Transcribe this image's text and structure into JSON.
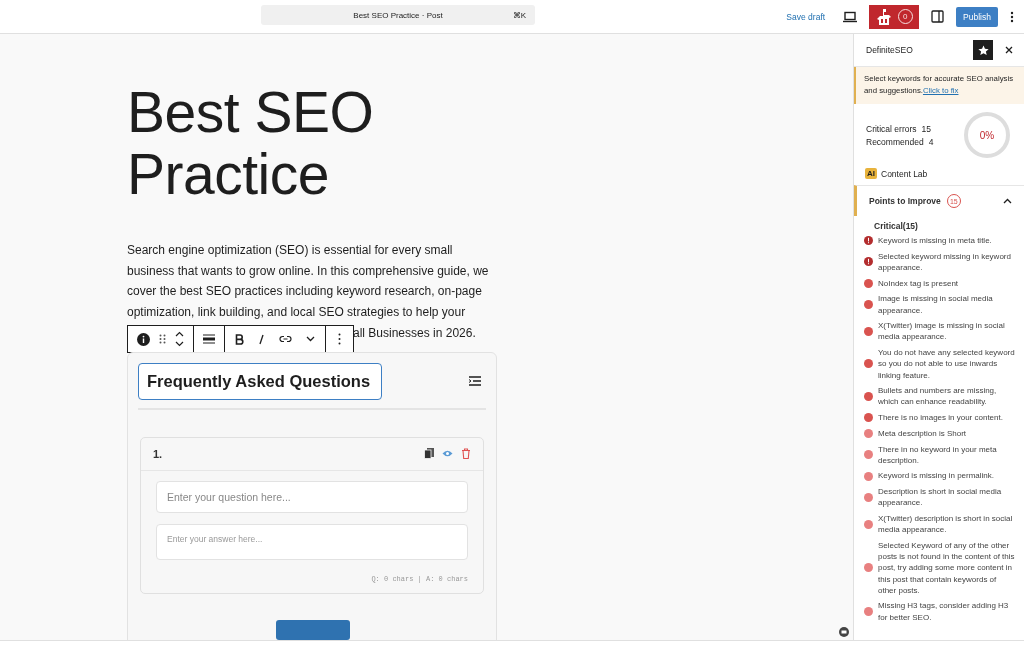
{
  "top_bar": {
    "document_title": "Best SEO Practice · Post",
    "shortcut": "⌘K",
    "save_draft": "Save draft",
    "plugin_score": "0",
    "publish": "Publish"
  },
  "editor": {
    "title": "Best SEO Practice",
    "paragraph": "Search engine optimization (SEO) is essential for every small business that wants to grow online. In this comprehensive guide, we cover the best SEO practices including keyword research, on-page optimization, link building, and local SEO strategies to help your",
    "paragraph_tail": "all Businesses in 2026.",
    "faq": {
      "heading": "Frequently Asked Questions",
      "items": [
        {
          "number": "1.",
          "question_placeholder": "Enter your question here...",
          "answer_placeholder": "Enter your answer here...",
          "counter": "Q: 0 chars | A: 0 chars"
        }
      ]
    }
  },
  "sidebar": {
    "title": "DefiniteSEO",
    "notice": "Select keywords for accurate SEO analysis and suggestions.",
    "notice_link": "Click to fix",
    "critical_errors_label": "Critical errors",
    "critical_errors": "15",
    "recommended_label": "Recommended",
    "recommended": "4",
    "score": "0%",
    "ai_badge": "AI",
    "content_lab": "Content Lab",
    "section": {
      "title": "Points to Improve",
      "count": "15",
      "expanded": true,
      "group": "Critical(15)",
      "issues": [
        {
          "kind": "alert",
          "color": "#b32d2e",
          "text": "Keyword is missing in meta title."
        },
        {
          "kind": "alert",
          "color": "#b32d2e",
          "text": "Selected keyword missing in keyword appearance."
        },
        {
          "kind": "dot",
          "color": "#d9534f",
          "text": "NoIndex tag is present"
        },
        {
          "kind": "dot",
          "color": "#d9534f",
          "text": "Image is missing in social media appearance."
        },
        {
          "kind": "dot",
          "color": "#d9534f",
          "text": "X(Twitter) image is missing in social media appearance."
        },
        {
          "kind": "dot",
          "color": "#d9534f",
          "text": "You do not have any selected keyword so you do not able to use inwards linking feature."
        },
        {
          "kind": "dot",
          "color": "#d9534f",
          "text": "Bullets and numbers are missing, which can enhance readability."
        },
        {
          "kind": "dot",
          "color": "#d9534f",
          "text": "There is no images in your content."
        },
        {
          "kind": "dot",
          "color": "#e88080",
          "text": "Meta description is Short"
        },
        {
          "kind": "dot",
          "color": "#e88080",
          "text": "There in no keyword in your meta description."
        },
        {
          "kind": "dot",
          "color": "#e88080",
          "text": "Keyword is missing in permalink."
        },
        {
          "kind": "dot",
          "color": "#e88080",
          "text": "Description is short in social media appearance."
        },
        {
          "kind": "dot",
          "color": "#e88080",
          "text": "X(Twitter) description is short in social media appearance."
        },
        {
          "kind": "dot",
          "color": "#e88080",
          "text": "Selected Keyword of any of the other posts is not found in the content of this post, try adding some more content in this post that contain keywords of other posts."
        },
        {
          "kind": "dot",
          "color": "#e88080",
          "text": "Missing H3 tags, consider adding H3 for better SEO."
        }
      ]
    }
  }
}
